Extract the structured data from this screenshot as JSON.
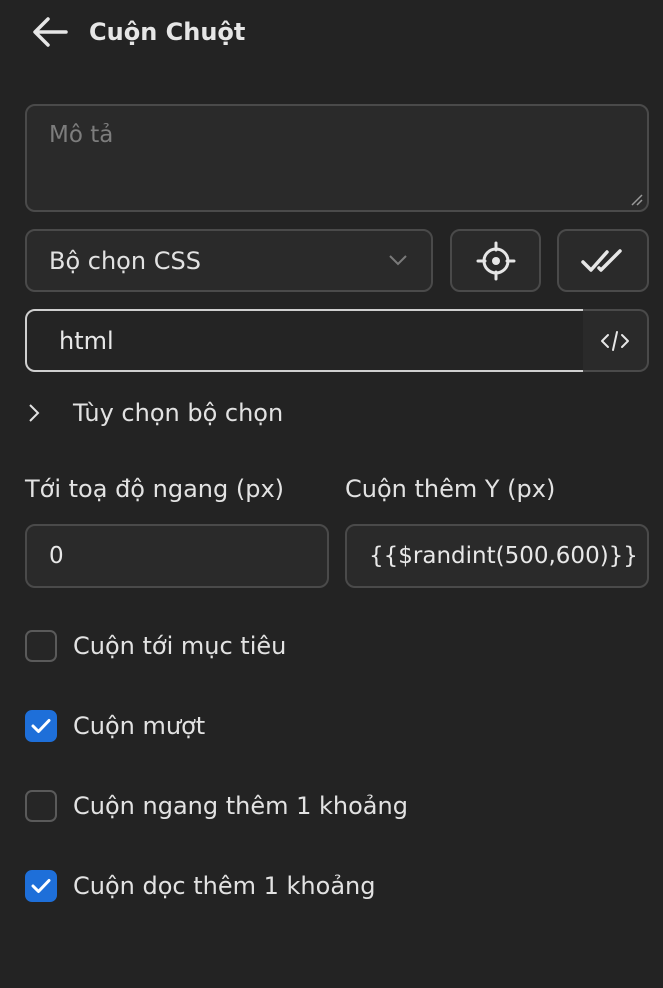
{
  "header": {
    "title": "Cuộn Chuột",
    "back_icon": "arrow-left-icon"
  },
  "description": {
    "placeholder": "Mô tả",
    "value": ""
  },
  "selector_type": {
    "selected": "Bộ chọn CSS"
  },
  "selector": {
    "value": "html"
  },
  "selector_options": {
    "label": "Tùy chọn bộ chọn",
    "expanded": false
  },
  "scroll_x": {
    "label": "Tới toạ độ ngang (px)",
    "value": "0"
  },
  "scroll_y": {
    "label": "Cuộn thêm Y (px)",
    "value": "{{$randint(500,600)}}"
  },
  "checkboxes": [
    {
      "label": "Cuộn tới mục tiêu",
      "checked": false
    },
    {
      "label": "Cuộn mượt",
      "checked": true
    },
    {
      "label": "Cuộn ngang thêm 1 khoảng",
      "checked": false
    },
    {
      "label": "Cuộn dọc thêm 1 khoảng",
      "checked": true
    }
  ],
  "colors": {
    "accent": "#1e6fd9",
    "background": "#232323",
    "field": "#2a2a2a",
    "border": "#4a4a4a"
  }
}
